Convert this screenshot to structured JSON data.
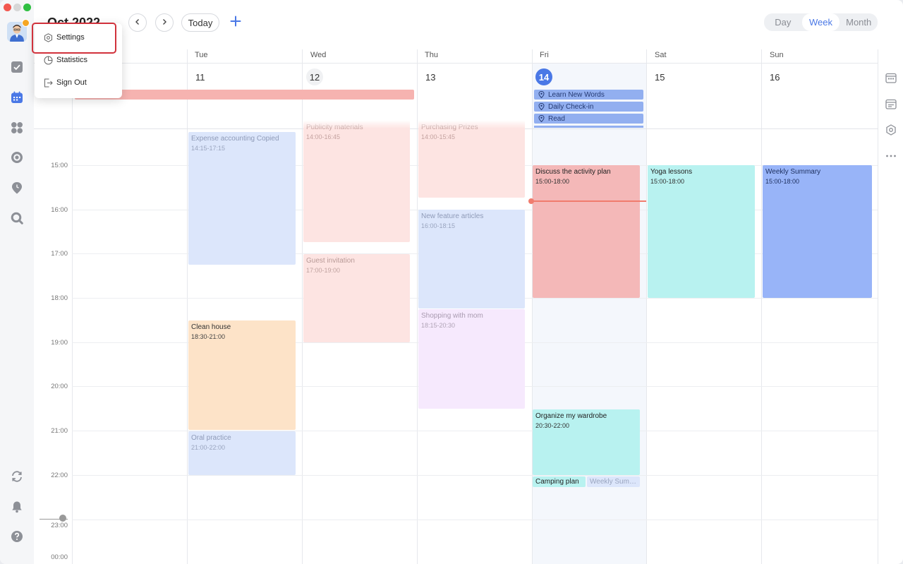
{
  "window": {
    "title": "Oct 2022"
  },
  "toolbar": {
    "month_title": "Oct 2022",
    "today_label": "Today",
    "views": [
      "Day",
      "Week",
      "Month"
    ],
    "active_view": "Week"
  },
  "user_menu": {
    "items": [
      "Settings",
      "Statistics",
      "Sign Out"
    ]
  },
  "week": {
    "days": [
      {
        "dow": "",
        "num": ""
      },
      {
        "dow": "Tue",
        "num": "11"
      },
      {
        "dow": "Wed",
        "num": "12"
      },
      {
        "dow": "Thu",
        "num": "13"
      },
      {
        "dow": "Fri",
        "num": "14"
      },
      {
        "dow": "Sat",
        "num": "15"
      },
      {
        "dow": "Sun",
        "num": "16"
      }
    ]
  },
  "allday_events": [
    "Learn New Words",
    "Daily Check-in",
    "Read"
  ],
  "times": [
    "15:00",
    "16:00",
    "17:00",
    "18:00",
    "19:00",
    "20:00",
    "21:00",
    "22:00",
    "23:00",
    "00:00"
  ],
  "events": {
    "tue_1": {
      "title": "Expense accounting Copied",
      "time": "14:15-17:15"
    },
    "tue_2": {
      "title": "Clean house",
      "time": "18:30-21:00"
    },
    "tue_3": {
      "title": "Oral practice",
      "time": "21:00-22:00"
    },
    "wed_1": {
      "title": "Publicity materials",
      "time": "14:00-16:45"
    },
    "wed_2": {
      "title": "Guest invitation",
      "time": "17:00-19:00"
    },
    "thu_1": {
      "title": "Purchasing Prizes",
      "time": "14:00-15:45"
    },
    "thu_2": {
      "title": "New feature articles",
      "time": "16:00-18:15"
    },
    "thu_3": {
      "title": "Shopping with mom",
      "time": "18:15-20:30"
    },
    "fri_1": {
      "title": "Discuss the activity plan",
      "time": "15:00-18:00"
    },
    "fri_2": {
      "title": "Organize my wardrobe",
      "time": "20:30-22:00"
    },
    "fri_3": {
      "title": "Camping plan",
      "time": ""
    },
    "fri_4": {
      "title": "Weekly Summa",
      "time": ""
    },
    "sat_1": {
      "title": "Yoga lessons",
      "time": "15:00-18:00"
    },
    "sun_1": {
      "title": "Weekly Summary",
      "time": "15:00-18:00"
    }
  },
  "colors": {
    "accent": "#4a78e6",
    "blue_event": "#dce6fb",
    "pink_event": "#fde4e2",
    "orange_event": "#fde3c8",
    "purple_event": "#f6e9fd",
    "red_event": "#f4b8b8",
    "teal_event": "#b8f2f0",
    "deep_blue_event": "#98b4f8",
    "now_line": "#f07c6e",
    "highlight": "#d1323c"
  },
  "icons": {
    "rail": [
      "check-square-icon",
      "calendar-icon",
      "grid-four-icon",
      "target-icon",
      "pin-clock-icon",
      "search-icon",
      "sync-icon",
      "bell-icon",
      "help-icon"
    ],
    "right_rail": [
      "calendar-small-icon",
      "calendar-list-icon",
      "settings-badge-icon",
      "more-icon"
    ]
  }
}
